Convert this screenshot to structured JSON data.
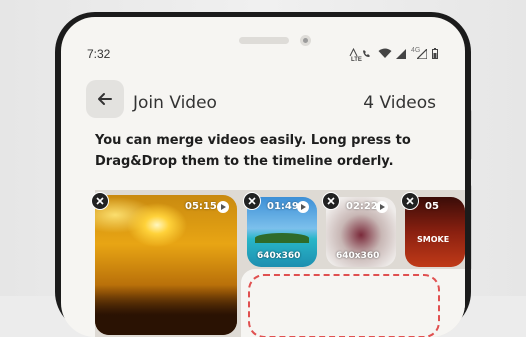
{
  "status_bar": {
    "time": "7:32",
    "lte_label": "LTE",
    "network_label": "4G"
  },
  "header": {
    "back_icon": "arrow-left-icon",
    "title": "Join Video",
    "video_count": "4 Videos"
  },
  "description": "You can merge videos easily. Long press to Drag&Drop them to the timeline orderly.",
  "clips": [
    {
      "duration": "05:15",
      "resolution": "",
      "label": ""
    },
    {
      "duration": "01:49",
      "resolution": "640x360",
      "label": ""
    },
    {
      "duration": "02:22",
      "resolution": "640x360",
      "label": ""
    },
    {
      "duration": "05",
      "resolution": "",
      "label": "SMOKE"
    }
  ],
  "colors": {
    "accent_dashed": "#e05050",
    "background": "#f6f5f2",
    "strip": "#dedad4"
  }
}
